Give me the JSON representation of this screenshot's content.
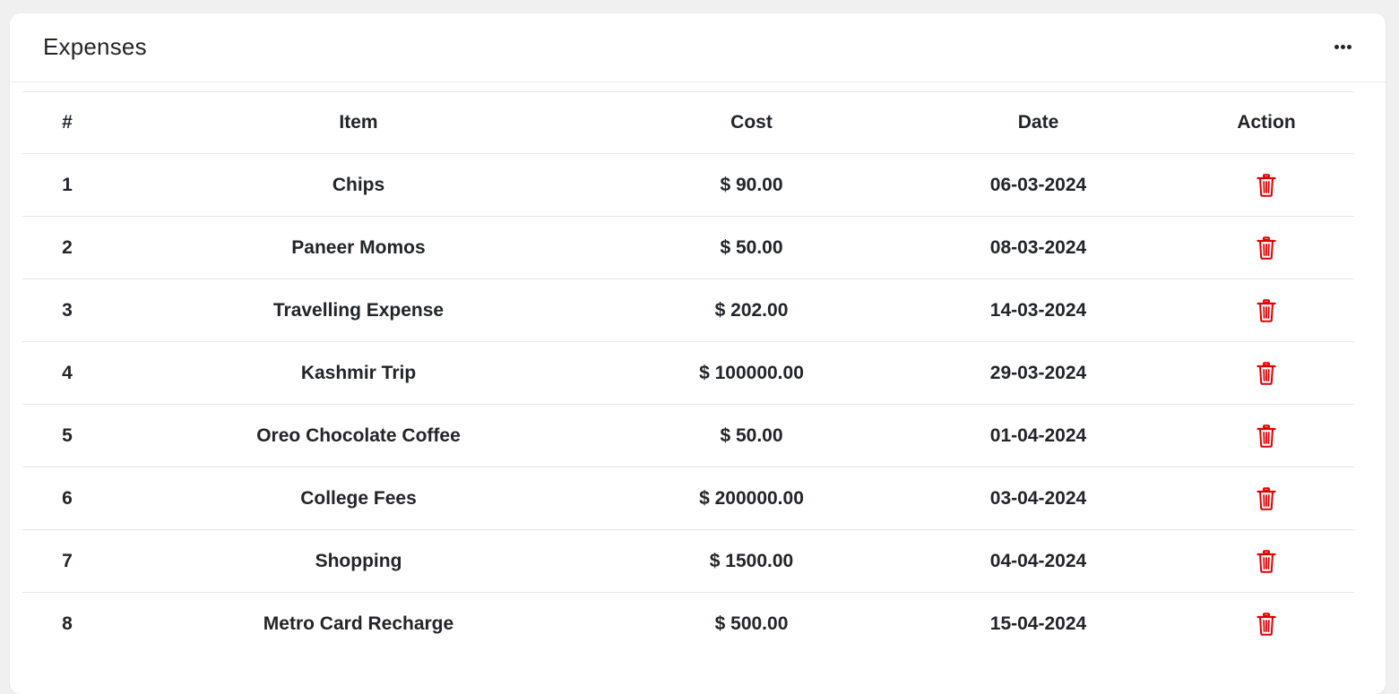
{
  "card": {
    "title": "Expenses",
    "more_icon": "more-horizontal-icon"
  },
  "table": {
    "headers": [
      "#",
      "Item",
      "Cost",
      "Date",
      "Action"
    ],
    "rows": [
      {
        "num": "1",
        "item": "Chips",
        "cost": "$ 90.00",
        "date": "06-03-2024"
      },
      {
        "num": "2",
        "item": "Paneer Momos",
        "cost": "$ 50.00",
        "date": "08-03-2024"
      },
      {
        "num": "3",
        "item": "Travelling Expense",
        "cost": "$ 202.00",
        "date": "14-03-2024"
      },
      {
        "num": "4",
        "item": "Kashmir Trip",
        "cost": "$ 100000.00",
        "date": "29-03-2024"
      },
      {
        "num": "5",
        "item": "Oreo Chocolate Coffee",
        "cost": "$ 50.00",
        "date": "01-04-2024"
      },
      {
        "num": "6",
        "item": "College Fees",
        "cost": "$ 200000.00",
        "date": "03-04-2024"
      },
      {
        "num": "7",
        "item": "Shopping",
        "cost": "$ 1500.00",
        "date": "04-04-2024"
      },
      {
        "num": "8",
        "item": "Metro Card Recharge",
        "cost": "$ 500.00",
        "date": "15-04-2024"
      }
    ],
    "action_icon": "trash-icon"
  },
  "colors": {
    "delete_icon": "#e30000",
    "text": "#212529",
    "background": "#f0f0f0",
    "card": "#ffffff"
  }
}
